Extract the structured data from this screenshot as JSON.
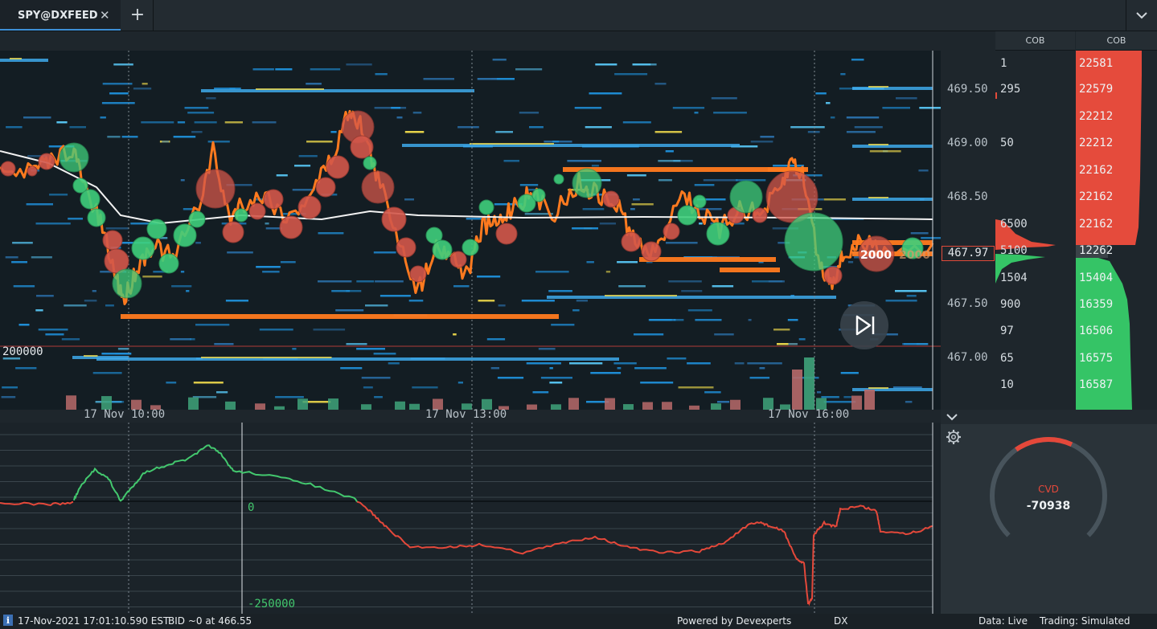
{
  "tab": {
    "title": "SPY@DXFEED",
    "close_icon": "close-icon",
    "add_icon": "plus-icon",
    "menu_icon": "chevron-down-icon"
  },
  "price_axis": {
    "labels": [
      "469.50",
      "469.00",
      "468.50",
      "467.50",
      "467.00"
    ],
    "current_price": "467.97"
  },
  "cob_left": {
    "header": "COB",
    "values": [
      "1",
      "295",
      "50",
      "6500",
      "5100",
      "1504",
      "900",
      "97",
      "65",
      "10"
    ]
  },
  "cob_right": {
    "header": "COB",
    "ask_values": [
      "22581",
      "22579",
      "22212",
      "22212",
      "22162",
      "22162",
      "22162"
    ],
    "mid_value": "12262",
    "bid_values": [
      "15404",
      "16359",
      "16506",
      "16575",
      "16587"
    ],
    "ask_color": "#e54b3c",
    "bid_color": "#35c466"
  },
  "heatmap": {
    "volume_label": "200000",
    "trade_labels": [
      "2000",
      "2000"
    ],
    "play_icon": "skip-forward-icon",
    "buy_color": "#3fcf7c",
    "sell_color": "#d3574a",
    "trade_line_color": "#ff7a1f"
  },
  "time_axis": {
    "labels": [
      "17 Nov 10:00",
      "17 Nov 13:00",
      "17 Nov 16:00"
    ]
  },
  "cvd_chart": {
    "zero_label": "0",
    "low_label": "-250000",
    "up_color": "#43c86e",
    "down_color": "#e4483a"
  },
  "gauge": {
    "label": "CVD",
    "value": "-70938",
    "fraction": 0.22,
    "settings_icon": "gear-icon",
    "collapse_icon": "chevron-down-icon"
  },
  "status": {
    "info_icon": "info-icon",
    "datetime": "17-Nov-2021 17:01:10.590 EST",
    "bid": "BID ~0 at 466.55",
    "powered": "Powered by Devexperts",
    "dx": "DX",
    "data": "Data: Live",
    "trading": "Trading: Simulated"
  }
}
